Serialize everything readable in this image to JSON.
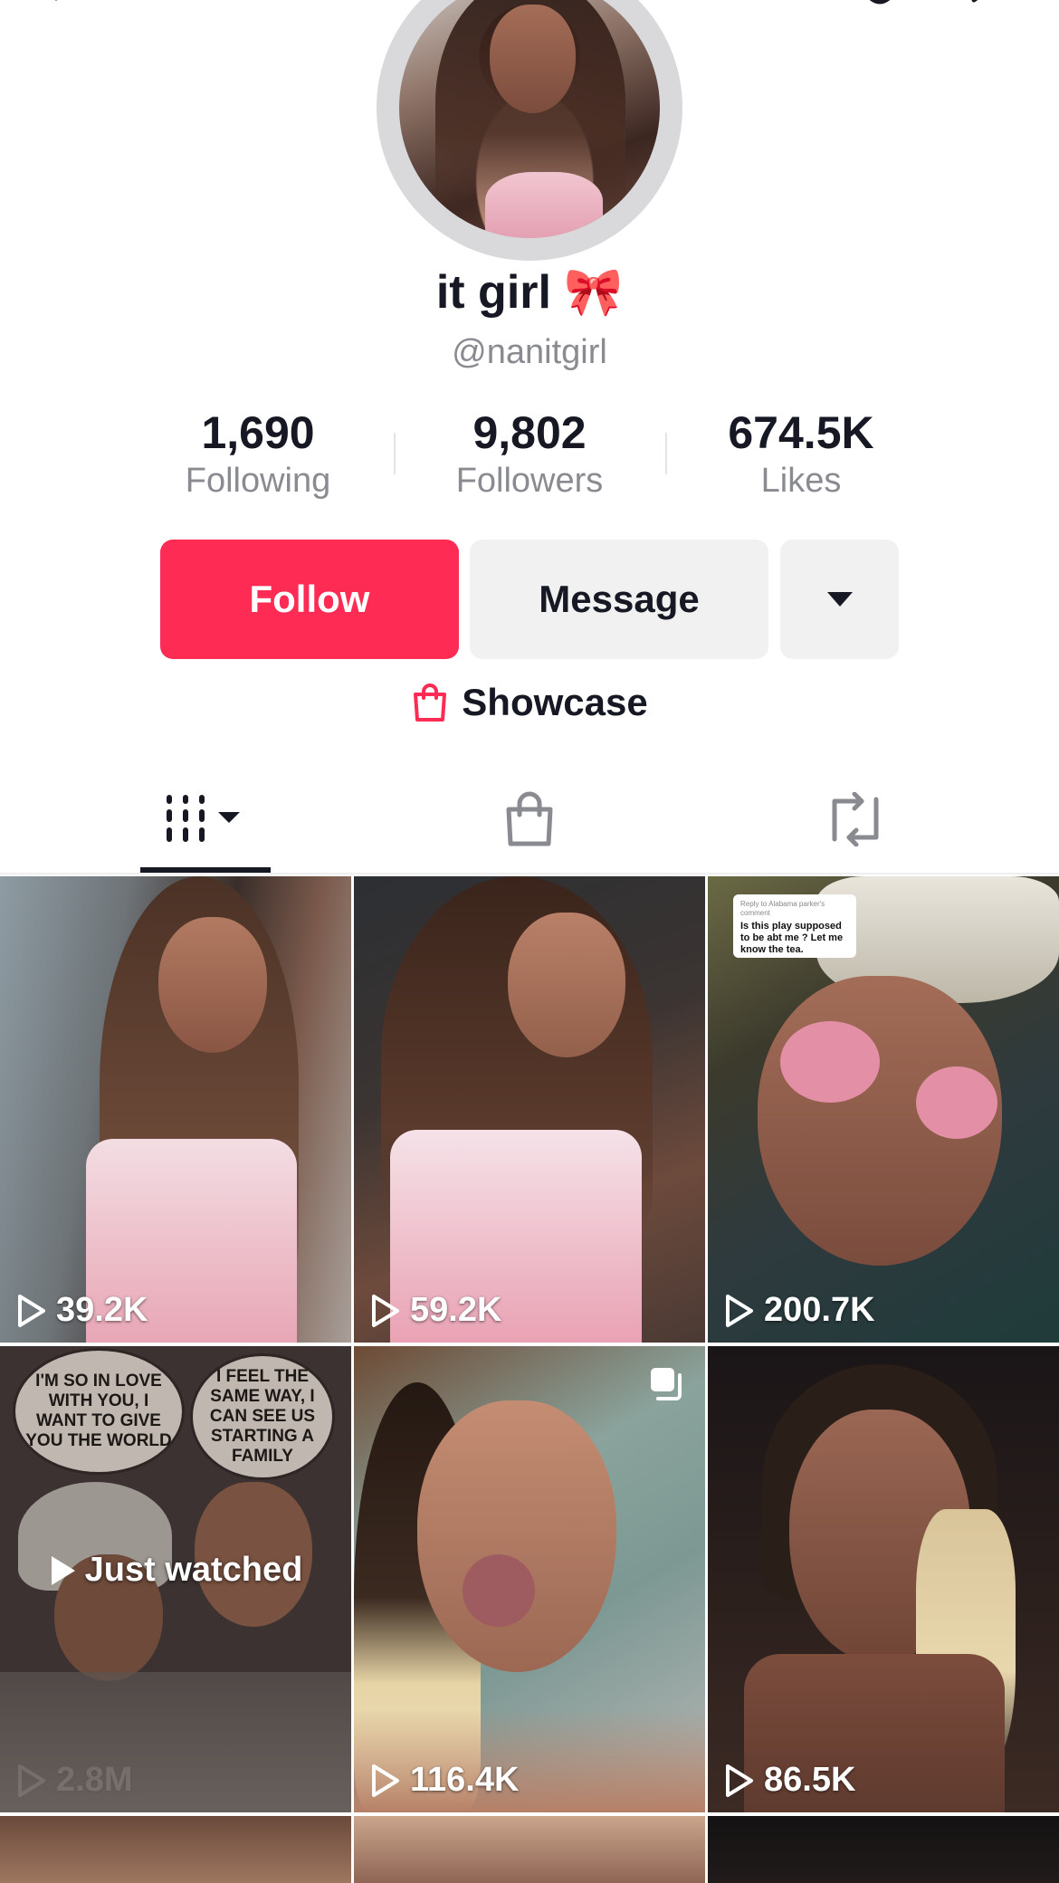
{
  "profile": {
    "display_name": "it girl 🎀",
    "username": "@nanitgirl"
  },
  "stats": [
    {
      "value": "1,690",
      "label": "Following"
    },
    {
      "value": "9,802",
      "label": "Followers"
    },
    {
      "value": "674.5K",
      "label": "Likes"
    }
  ],
  "actions": {
    "follow_label": "Follow",
    "message_label": "Message"
  },
  "showcase": {
    "label": "Showcase"
  },
  "tabs": [
    {
      "icon": "videos-grid-icon",
      "selected": true
    },
    {
      "icon": "shop-bag-icon",
      "selected": false
    },
    {
      "icon": "repost-icon",
      "selected": false
    }
  ],
  "videos": [
    {
      "views": "39.2K"
    },
    {
      "views": "59.2K"
    },
    {
      "views": "200.7K",
      "sticker": {
        "reply_to": "Reply to Alabama parker's comment",
        "text": "Is this play supposed to be abt me ? Let me know the tea."
      }
    },
    {
      "views": "2.8M",
      "overlay": "Just watched",
      "bubbles": [
        "I'M SO IN LOVE WITH YOU, I WANT TO GIVE YOU THE WORLD",
        "I FEEL THE SAME WAY, I CAN SEE US STARTING A FAMILY"
      ]
    },
    {
      "views": "116.4K",
      "carousel": true
    },
    {
      "views": "86.5K"
    }
  ],
  "colors": {
    "accent": "#fe2c55",
    "text": "#161823",
    "secondary_text": "#8a8b91",
    "button_gray": "#f1f1f2"
  }
}
